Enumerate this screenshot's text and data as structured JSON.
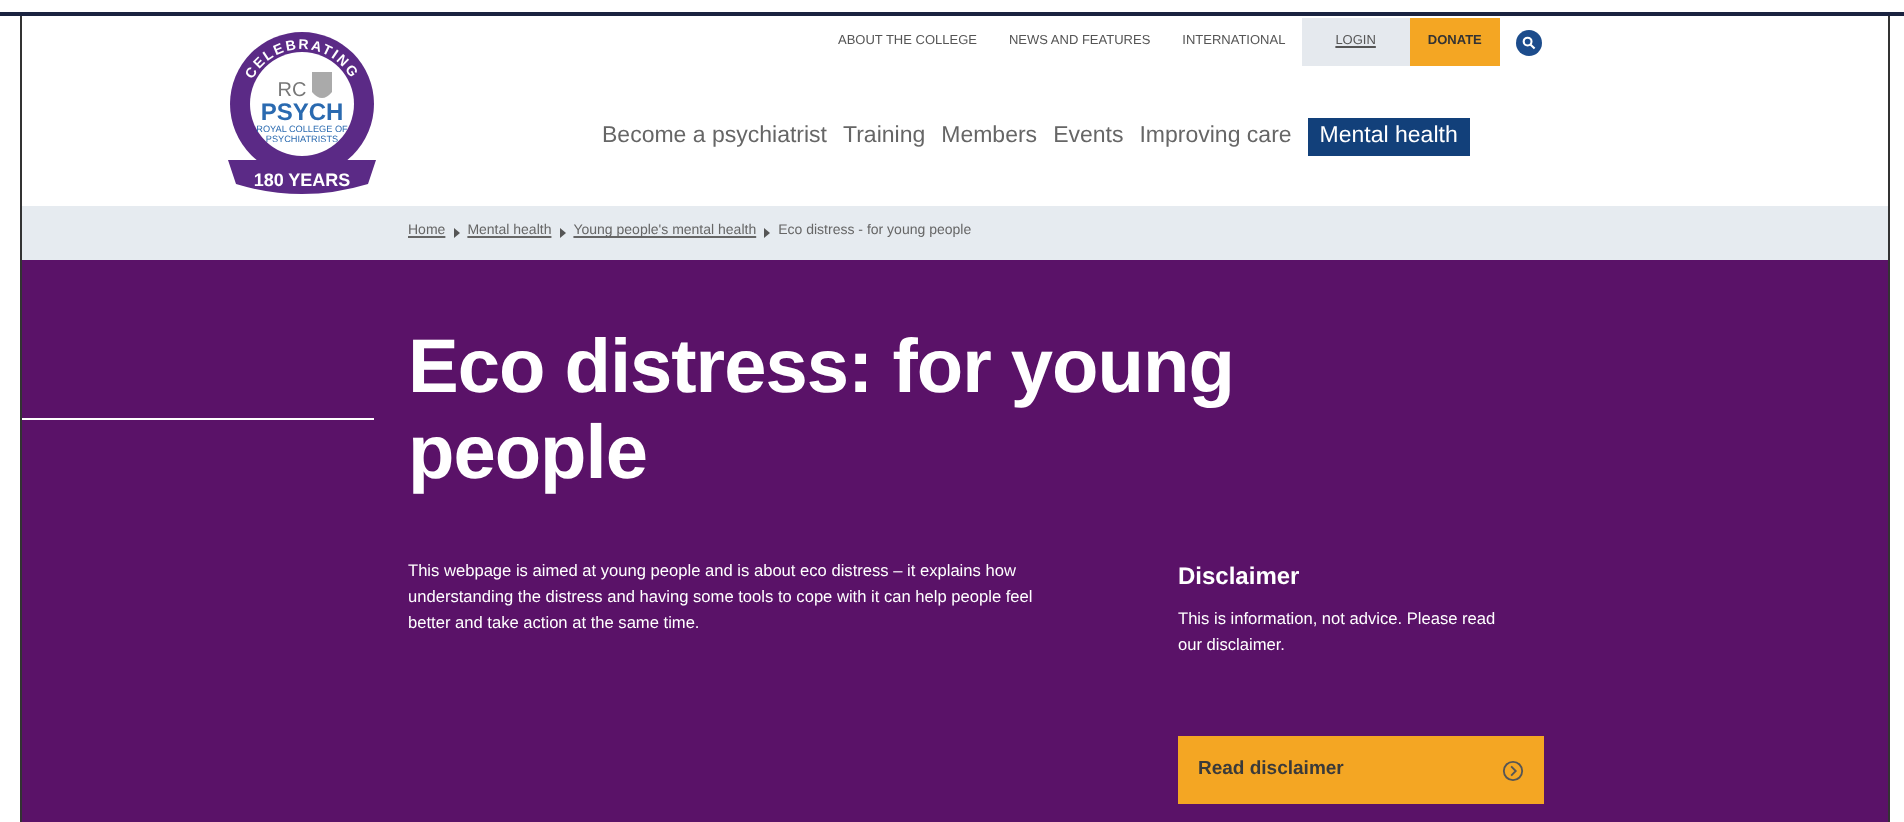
{
  "logo": {
    "arc_text": "CELEBRATING",
    "initials": "RC",
    "name": "PSYCH",
    "subtitle": [
      "ROYAL COLLEGE OF",
      "PSYCHIATRISTS"
    ],
    "ribbon": "180 YEARS"
  },
  "top_links": [
    {
      "label": "ABOUT THE COLLEGE",
      "kind": "plain"
    },
    {
      "label": "NEWS AND FEATURES",
      "kind": "plain"
    },
    {
      "label": "INTERNATIONAL",
      "kind": "plain"
    },
    {
      "label": "LOGIN",
      "kind": "login"
    },
    {
      "label": "DONATE",
      "kind": "donate"
    }
  ],
  "main_nav": [
    {
      "label": "Become a psychiatrist",
      "selected": false
    },
    {
      "label": "Training",
      "selected": false
    },
    {
      "label": "Members",
      "selected": false
    },
    {
      "label": "Events",
      "selected": false
    },
    {
      "label": "Improving care",
      "selected": false
    },
    {
      "label": "Mental health",
      "selected": true
    }
  ],
  "breadcrumb": [
    {
      "label": "Home",
      "link": true
    },
    {
      "label": "Mental health",
      "link": true
    },
    {
      "label": "Young people's mental health",
      "link": true
    },
    {
      "label": "Eco distress - for young people",
      "link": false
    }
  ],
  "hero": {
    "title": "Eco distress: for young people",
    "intro": "This webpage is aimed at young people and is about eco distress – it explains how understanding the distress and having some tools to cope with it can help people feel better and take action at the same time.",
    "disclaimer": {
      "heading": "Disclaimer",
      "text": "This is information, not advice. Please read our disclaimer.",
      "button": "Read disclaimer"
    }
  }
}
